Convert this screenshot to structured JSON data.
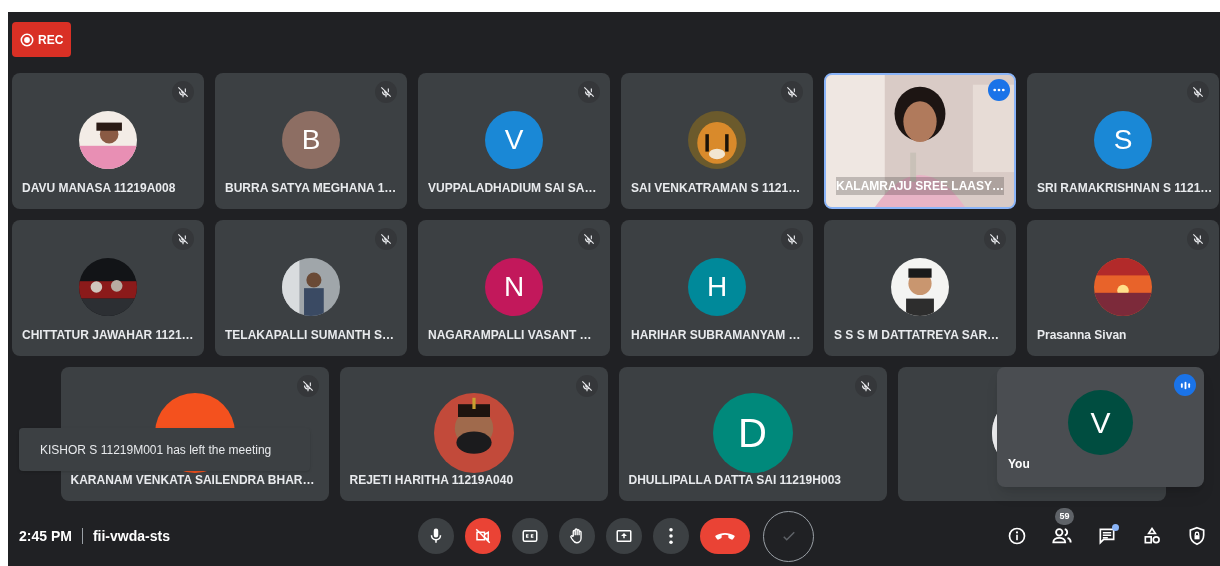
{
  "recording": {
    "label": "REC"
  },
  "rows": [
    {
      "tiles": [
        {
          "name": "DAVU MANASA 11219A008",
          "avatar": {
            "kind": "picture"
          },
          "muted": true,
          "highlighted": false
        },
        {
          "name": "BURRA SATYA MEGHANA 1…",
          "avatar": {
            "kind": "letter",
            "letter": "B",
            "color": "#8d6e63"
          },
          "muted": true,
          "highlighted": false
        },
        {
          "name": "VUPPALADHADIUM SAI SA…",
          "avatar": {
            "kind": "letter",
            "letter": "V",
            "color": "#1a88d6"
          },
          "muted": true,
          "highlighted": false
        },
        {
          "name": "SAI VENKATRAMAN S 1121…",
          "avatar": {
            "kind": "picture"
          },
          "muted": true,
          "highlighted": false
        },
        {
          "name": "KALAMRAJU SREE LAASY…",
          "avatar": {
            "kind": "video"
          },
          "muted": false,
          "highlighted": true
        },
        {
          "name": "SRI RAMAKRISHNAN S 1121…",
          "avatar": {
            "kind": "letter",
            "letter": "S",
            "color": "#1a88d6"
          },
          "muted": true,
          "highlighted": false
        }
      ]
    },
    {
      "tiles": [
        {
          "name": "CHITTATUR JAWAHAR 1121…",
          "avatar": {
            "kind": "picture"
          },
          "muted": true,
          "highlighted": false
        },
        {
          "name": "TELAKAPALLI SUMANTH S…",
          "avatar": {
            "kind": "picture"
          },
          "muted": true,
          "highlighted": false
        },
        {
          "name": "NAGARAMPALLI VASANT …",
          "avatar": {
            "kind": "letter",
            "letter": "N",
            "color": "#c2185b"
          },
          "muted": true,
          "highlighted": false
        },
        {
          "name": "HARIHAR SUBRAMANYAM …",
          "avatar": {
            "kind": "letter",
            "letter": "H",
            "color": "#00899a"
          },
          "muted": true,
          "highlighted": false
        },
        {
          "name": "S S S M DATTATREYA SAR…",
          "avatar": {
            "kind": "picture"
          },
          "muted": true,
          "highlighted": false
        },
        {
          "name": "Prasanna Sivan",
          "avatar": {
            "kind": "picture"
          },
          "muted": true,
          "highlighted": false
        }
      ]
    },
    {
      "tiles": [
        {
          "name": "KARANAM VENKATA SAILENDRA BHAR…",
          "avatar": {
            "kind": "letter",
            "color": "#f4511e"
          },
          "muted": true,
          "highlighted": false
        },
        {
          "name": "REJETI HARITHA 11219A040",
          "avatar": {
            "kind": "picture"
          },
          "muted": true,
          "highlighted": false
        },
        {
          "name": "DHULLIPALLA DATTA SAI 11219H003",
          "avatar": {
            "kind": "letter",
            "letter": "D",
            "color": "#00897b"
          },
          "muted": true,
          "highlighted": false
        },
        {
          "avatar": {
            "kind": "picture"
          }
        }
      ]
    }
  ],
  "self_view": {
    "label": "You",
    "letter": "V",
    "color": "#004d40"
  },
  "toast": {
    "text": "KISHOR S 11219M001 has left the meeting"
  },
  "bottom_bar": {
    "time": "2:45 PM",
    "meeting_code": "fii-vwda-sts",
    "camera_off": true,
    "people_count": "59",
    "chat_unread": true
  }
}
